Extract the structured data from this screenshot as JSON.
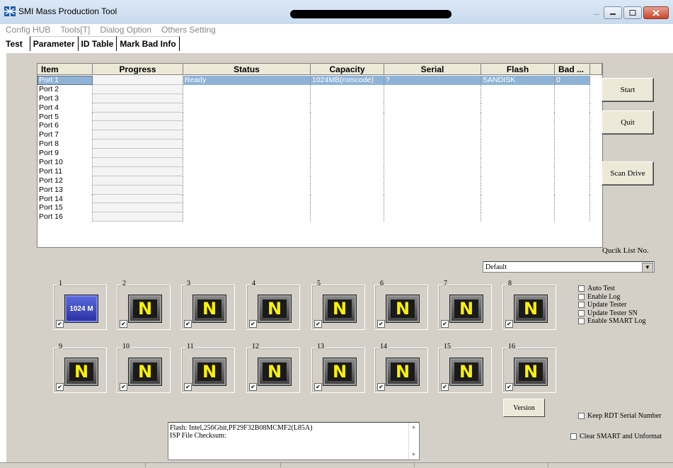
{
  "window": {
    "title": "SMI Mass Production Tool",
    "minimize_dots": "...",
    "buttons": [
      "minimize",
      "maximize",
      "close"
    ]
  },
  "menu": [
    "Config HUB",
    "Tools[T]",
    "Dialog Option",
    "Others Setting"
  ],
  "tabs": [
    "Test",
    "Parameter",
    "ID Table",
    "Mark Bad Info"
  ],
  "grid": {
    "columns": [
      "Item",
      "Progress",
      "Status",
      "Capacity",
      "Serial",
      "Flash",
      "Bad ..."
    ],
    "rows": [
      {
        "item": "Port 1",
        "status": "Ready",
        "capacity": "1024MB(romcode)",
        "serial": "?",
        "flash": "SANDISK",
        "bad": "0",
        "selected": true
      },
      {
        "item": "Port 2"
      },
      {
        "item": "Port 3"
      },
      {
        "item": "Port 4"
      },
      {
        "item": "Port 5"
      },
      {
        "item": "Port 6"
      },
      {
        "item": "Port 7"
      },
      {
        "item": "Port 8"
      },
      {
        "item": "Port 9"
      },
      {
        "item": "Port 10"
      },
      {
        "item": "Port 11"
      },
      {
        "item": "Port 12"
      },
      {
        "item": "Port 13"
      },
      {
        "item": "Port 14"
      },
      {
        "item": "Port 15"
      },
      {
        "item": "Port 16"
      }
    ]
  },
  "side_buttons": {
    "start": "Start",
    "quit": "Quit",
    "scan": "Scan Drive"
  },
  "quick_list": {
    "label": "Qucik List No.",
    "value": "Default"
  },
  "slots": [
    {
      "num": "1",
      "label": "1024 M",
      "active": true
    },
    {
      "num": "2",
      "label": "N"
    },
    {
      "num": "3",
      "label": "N"
    },
    {
      "num": "4",
      "label": "N"
    },
    {
      "num": "5",
      "label": "N"
    },
    {
      "num": "6",
      "label": "N"
    },
    {
      "num": "7",
      "label": "N"
    },
    {
      "num": "8",
      "label": "N"
    },
    {
      "num": "9",
      "label": "N"
    },
    {
      "num": "10",
      "label": "N"
    },
    {
      "num": "11",
      "label": "N"
    },
    {
      "num": "12",
      "label": "N"
    },
    {
      "num": "13",
      "label": "N"
    },
    {
      "num": "14",
      "label": "N"
    },
    {
      "num": "15",
      "label": "N"
    },
    {
      "num": "16",
      "label": "N"
    }
  ],
  "options": [
    "Auto Test",
    "Enable Log",
    "Update Tester",
    "Update Tester SN",
    "Enable SMART Log"
  ],
  "version_button": "Version",
  "keep_rdt": "Keep RDT Serial Number",
  "clear_smart": "Clear SMART and Unformat",
  "info": {
    "flash_line": "Flash: Intel,256Gbit,PF29F32B08MCMF2(L85A)",
    "isp_line": "ISP File Checksum:"
  }
}
